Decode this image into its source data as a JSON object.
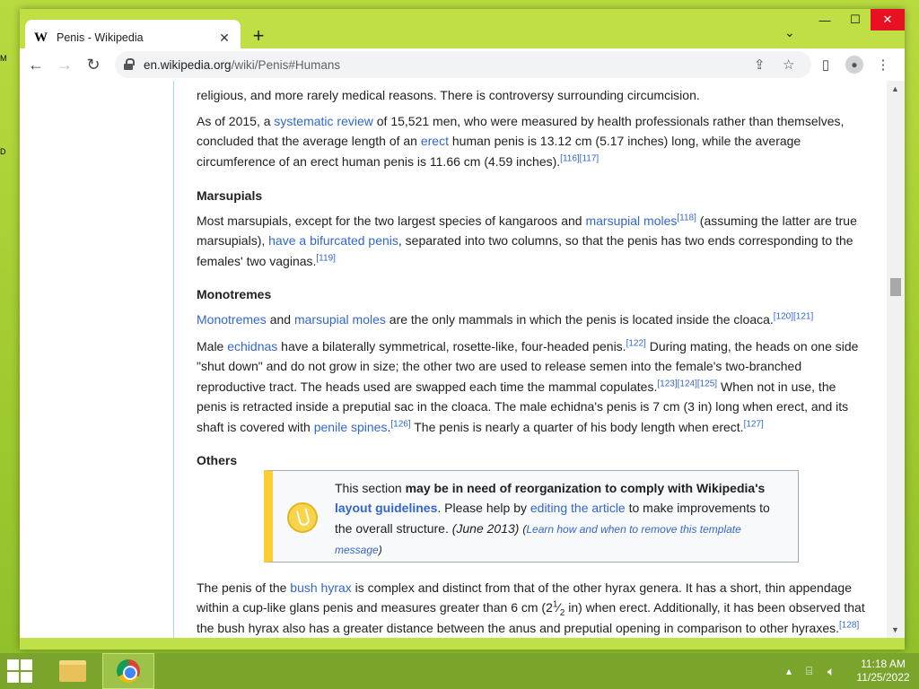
{
  "browser": {
    "tab_title": "Penis - Wikipedia",
    "tab_favicon": "W",
    "url_host": "en.wikipedia.org",
    "url_path": "/wiki/Penis#Humans"
  },
  "article": {
    "p0": "religious, and more rarely medical reasons. There is controversy surrounding circumcision.",
    "p1": {
      "t1": "As of 2015, a ",
      "a1": "systematic review",
      "t2": " of 15,521 men, who were measured by health professionals rather than themselves, concluded that the average length of an ",
      "a2": "erect",
      "t3": " human penis is 13.12 cm (5.17 inches) long, while the average circumference of an erect human penis is 11.66 cm (4.59 inches).",
      "ref": "[116][117]"
    },
    "h_marsupials": "Marsupials",
    "p2": {
      "t1": "Most marsupials, except for the two largest species of kangaroos and ",
      "a1": "marsupial moles",
      "ref1": "[118]",
      "t2": " (assuming the latter are true marsupials), ",
      "a2": "have a bifurcated penis",
      "t3": ", separated into two columns, so that the penis has two ends corresponding to the females' two vaginas.",
      "ref2": "[119]"
    },
    "h_monotremes": "Monotremes",
    "p3": {
      "a1": "Monotremes",
      "t1": " and ",
      "a2": "marsupial moles",
      "t2": " are the only mammals in which the penis is located inside the cloaca.",
      "ref": "[120][121]"
    },
    "p4": {
      "t1": "Male ",
      "a1": "echidnas",
      "t2": " have a bilaterally symmetrical, rosette-like, four-headed penis.",
      "ref1": "[122]",
      "t3": " During mating, the heads on one side \"shut down\" and do not grow in size; the other two are used to release semen into the female's two-branched reproductive tract. The heads used are swapped each time the mammal copulates.",
      "ref2": "[123][124][125]",
      "t4": " When not in use, the penis is retracted inside a preputial sac in the cloaca. The male echidna's penis is 7 cm (3 in) long when erect, and its shaft is covered with ",
      "a2": "penile spines",
      "ref3": "[126]",
      "t5": " The penis is nearly a quarter of his body length when erect.",
      "ref4": "[127]",
      "dot": "."
    },
    "h_others": "Others",
    "ambox": {
      "t1": "This section ",
      "b1": "may be in need of reorganization to comply with Wikipedia's ",
      "a1": "layout guidelines",
      "t2": ". Please help by ",
      "a2": "editing the article",
      "t3": " to make improvements to the overall structure. ",
      "date": "(June 2013)",
      "learn": "Learn how and when to remove this template message",
      "lp": "(",
      "rp": ")"
    },
    "p5": {
      "t1": "The penis of the ",
      "a1": "bush hyrax",
      "t2": " is complex and distinct from that of the other hyrax genera. It has a short, thin appendage within a cup-like glans penis and measures greater than 6 cm (2",
      "frac_n": "1",
      "frac_d": "2",
      "t3": " in) when erect. Additionally, it has been observed that the bush hyrax also has a greater distance between the anus and preputial opening in comparison to other hyraxes.",
      "ref": "[128]"
    }
  },
  "taskbar": {
    "time": "11:18 AM",
    "date": "11/25/2022"
  },
  "colors": {
    "link": "#3366cc",
    "desktop": "#a8cf3a",
    "ambox_accent": "#ffcc33"
  }
}
